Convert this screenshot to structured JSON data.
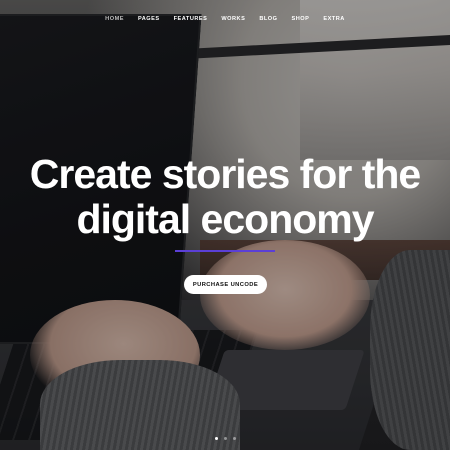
{
  "nav": {
    "items": [
      {
        "label": "HOME",
        "active": true
      },
      {
        "label": "PAGES",
        "active": false
      },
      {
        "label": "FEATURES",
        "active": false
      },
      {
        "label": "WORKS",
        "active": false
      },
      {
        "label": "BLOG",
        "active": false
      },
      {
        "label": "SHOP",
        "active": false
      },
      {
        "label": "EXTRA",
        "active": false
      }
    ]
  },
  "hero": {
    "headline_line1": "Create stories for the",
    "headline_line2": "digital economy",
    "cta_label": "PURCHASE UNCODE",
    "accent_color": "#5b3fd6"
  },
  "slider": {
    "total": 3,
    "active_index": 0
  }
}
